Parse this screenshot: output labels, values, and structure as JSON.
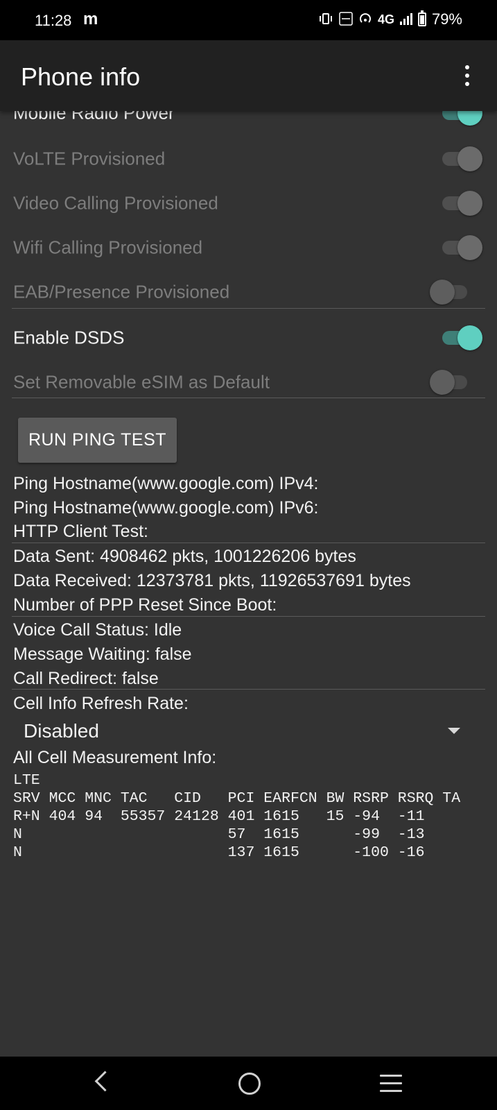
{
  "status_bar": {
    "time": "11:28",
    "notification_glyph": "m",
    "network": "4G",
    "battery_percent": "79%",
    "icons": [
      "vibrate-icon",
      "volte-icon",
      "hotspot-icon",
      "signal-icon",
      "battery-icon"
    ]
  },
  "app_bar": {
    "title": "Phone info",
    "menu_icon": "more-vert-icon"
  },
  "toggles": [
    {
      "label": "Mobile Radio Power",
      "state": "on",
      "enabled": true
    },
    {
      "label": "VoLTE Provisioned",
      "state": "on",
      "enabled": false
    },
    {
      "label": "Video Calling Provisioned",
      "state": "on",
      "enabled": false
    },
    {
      "label": "Wifi Calling Provisioned",
      "state": "on",
      "enabled": false
    },
    {
      "label": "EAB/Presence Provisioned",
      "state": "off",
      "enabled": false
    },
    {
      "label": "Enable DSDS",
      "state": "on",
      "enabled": true
    },
    {
      "label": "Set Removable eSIM as Default",
      "state": "off",
      "enabled": false
    }
  ],
  "ping_button_label": "RUN PING TEST",
  "info": {
    "ping_ipv4": "Ping Hostname(www.google.com) IPv4:",
    "ping_ipv6": "Ping Hostname(www.google.com) IPv6:",
    "http_test": "HTTP Client Test:",
    "data_sent_label": "Data Sent:",
    "data_sent_value": "4908462 pkts, 1001226206 bytes",
    "data_received_label": "Data Received:",
    "data_received_value": "12373781 pkts, 11926537691 bytes",
    "ppp_reset_label": "Number of PPP Reset Since Boot:",
    "voice_call_label": "Voice Call Status:",
    "voice_call_value": "Idle",
    "message_waiting_label": "Message Waiting:",
    "message_waiting_value": "false",
    "call_redirect_label": "Call Redirect:",
    "call_redirect_value": "false",
    "refresh_rate_label": "Cell Info Refresh Rate:",
    "refresh_rate_value": "Disabled",
    "cell_measure_label": "All Cell Measurement Info:"
  },
  "cell_table": {
    "lines": [
      "LTE",
      "SRV MCC MNC TAC   CID   PCI EARFCN BW RSRP RSRQ TA",
      "R+N 404 94  55357 24128 401 1615   15 -94  -11",
      "N                       57  1615      -99  -13",
      "N                       137 1615      -100 -16"
    ]
  },
  "colors": {
    "background": "#333333",
    "app_bar": "#212121",
    "accent": "#5fcfc0",
    "disabled_text": "#7d7d7d",
    "button": "#5a5a5a"
  }
}
